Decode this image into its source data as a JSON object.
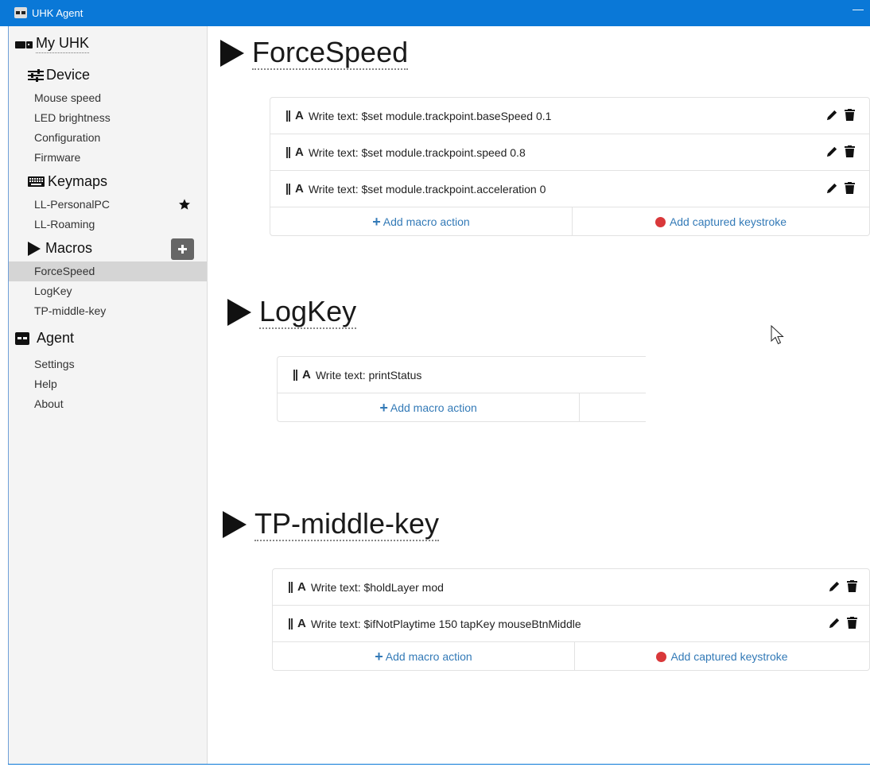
{
  "window": {
    "title": "UHK Agent",
    "minimize": "—"
  },
  "sidebar": {
    "my_uhk": "My UHK",
    "device": {
      "label": "Device",
      "items": [
        "Mouse speed",
        "LED brightness",
        "Configuration",
        "Firmware"
      ]
    },
    "keymaps": {
      "label": "Keymaps",
      "items": [
        "LL-PersonalPC",
        "LL-Roaming"
      ]
    },
    "macros": {
      "label": "Macros",
      "items": [
        "ForceSpeed",
        "LogKey",
        "TP-middle-key"
      ]
    },
    "agent": {
      "label": "Agent",
      "items": [
        "Settings",
        "Help",
        "About"
      ]
    }
  },
  "macros": [
    {
      "name": "ForceSpeed",
      "actions": [
        "Write text: $set module.trackpoint.baseSpeed 0.1",
        "Write text: $set module.trackpoint.speed 0.8",
        "Write text: $set module.trackpoint.acceleration 0"
      ]
    },
    {
      "name": "LogKey",
      "actions": [
        "Write text: printStatus"
      ]
    },
    {
      "name": "TP-middle-key",
      "actions": [
        "Write text: $holdLayer mod",
        "Write text: $ifNotPlaytime 150 tapKey mouseBtnMiddle"
      ]
    }
  ],
  "labels": {
    "add_action": "Add macro action",
    "add_keystroke": "Add captured keystroke"
  },
  "colors": {
    "titlebar": "#0a78d7",
    "link": "#337ab7",
    "record": "#d9383a",
    "active_item": "#d5d5d5"
  }
}
